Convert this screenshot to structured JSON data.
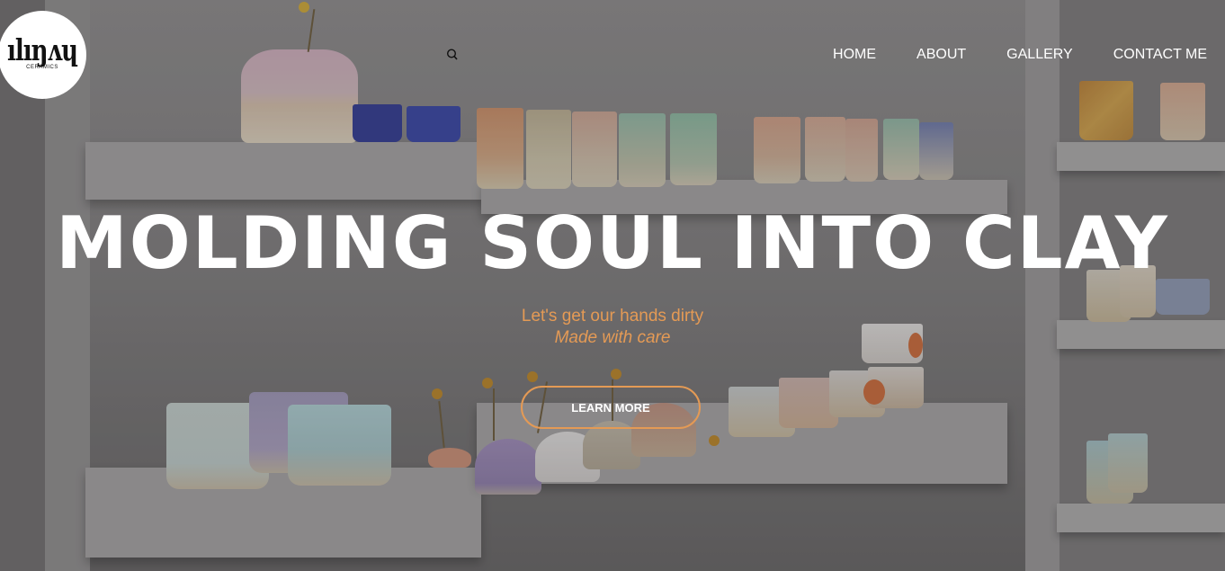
{
  "brand": {
    "logo_text": "ılıŋʌɥ",
    "logo_subtext": "CERAMICS"
  },
  "nav": {
    "search_icon": "search-icon",
    "items": [
      {
        "label": "HOME"
      },
      {
        "label": "ABOUT"
      },
      {
        "label": "GALLERY"
      },
      {
        "label": "CONTACT ME"
      }
    ]
  },
  "hero": {
    "headline": "MOLDING SOUL INTO CLAY",
    "tagline": "Let's get our hands dirty",
    "tagline_italic": "Made with care",
    "cta_label": "LEARN MORE"
  },
  "colors": {
    "accent": "#e49a55",
    "text_light": "#ffffff",
    "logo_bg": "#ffffff"
  }
}
